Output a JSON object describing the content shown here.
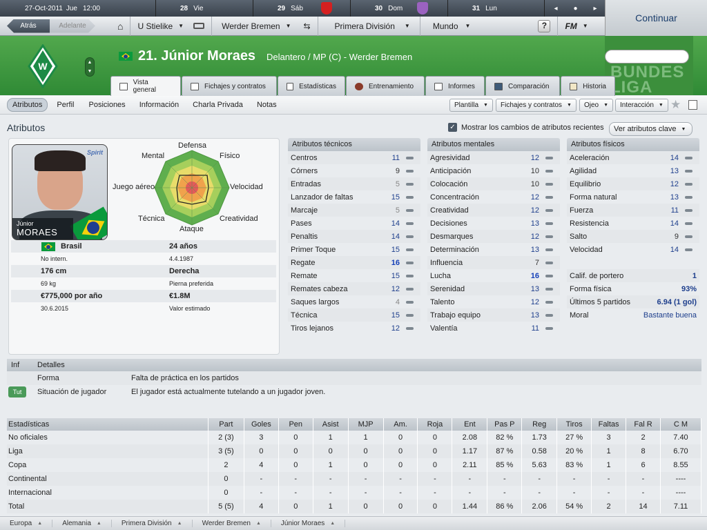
{
  "topbar": {
    "date": "27-Oct-2011",
    "weekday": "Jue",
    "time": "12:00",
    "days": [
      {
        "num": "28",
        "name": "Vie",
        "crest": ""
      },
      {
        "num": "29",
        "name": "Sáb",
        "crest": "#d42020"
      },
      {
        "num": "30",
        "name": "Dom",
        "crest": "#9b62c0"
      },
      {
        "num": "31",
        "name": "Lun",
        "crest": ""
      }
    ]
  },
  "nav": {
    "back": "Atrás",
    "forward": "Adelante",
    "manager": "U Stielike",
    "club": "Werder Bremen",
    "league": "Primera División",
    "world": "Mundo",
    "help": "?",
    "fm": "FM",
    "continue": "Continuar"
  },
  "player": {
    "title": "21. Júnior Moraes",
    "position": "Delantero / MP (C) - Werder Bremen",
    "first_name": "Júnior",
    "last_name": "MORAES",
    "logo_text": "Spirit"
  },
  "tabs": [
    "Vista general",
    "Fichajes y contratos",
    "Estadísticas",
    "Entrenamiento",
    "Informes",
    "Comparación",
    "Historia"
  ],
  "subnav": [
    "Atributos",
    "Perfil",
    "Posiciones",
    "Información",
    "Charla Privada",
    "Notas"
  ],
  "toolbar": {
    "squad": "Plantilla",
    "transfers": "Fichajes y contratos",
    "scout": "Ojeo",
    "interaction": "Interacción"
  },
  "section": {
    "title": "Atributos",
    "show_changes": "Mostrar los cambios de atributos recientes",
    "key_attrs": "Ver atributos clave"
  },
  "radar_labels": {
    "top": "Defensa",
    "tr": "Físico",
    "r": "Velocidad",
    "br": "Creatividad",
    "b": "Ataque",
    "bl": "Técnica",
    "l": "Juego aéreo",
    "tl": "Mental"
  },
  "info": {
    "nation": "Brasil",
    "caps": "No intern.",
    "age": "24 años",
    "dob": "4.4.1987",
    "height": "176 cm",
    "weight": "69 kg",
    "foot": "Derecha",
    "foot_label": "Pierna preferida",
    "wage": "€775,000 por año",
    "expires": "30.6.2015",
    "value": "€1.8M",
    "value_label": "Valor estimado"
  },
  "technical": {
    "title": "Atributos técnicos",
    "rows": [
      {
        "n": "Centros",
        "v": "11",
        "s": ""
      },
      {
        "n": "Córners",
        "v": "9",
        "s": "blk"
      },
      {
        "n": "Entradas",
        "v": "5",
        "s": "dim"
      },
      {
        "n": "Lanzador de faltas",
        "v": "15",
        "s": ""
      },
      {
        "n": "Marcaje",
        "v": "5",
        "s": "dim"
      },
      {
        "n": "Pases",
        "v": "14",
        "s": ""
      },
      {
        "n": "Penaltis",
        "v": "14",
        "s": ""
      },
      {
        "n": "Primer Toque",
        "v": "15",
        "s": ""
      },
      {
        "n": "Regate",
        "v": "16",
        "s": "hi"
      },
      {
        "n": "Remate",
        "v": "15",
        "s": ""
      },
      {
        "n": "Remates cabeza",
        "v": "12",
        "s": ""
      },
      {
        "n": "Saques largos",
        "v": "4",
        "s": "dim"
      },
      {
        "n": "Técnica",
        "v": "15",
        "s": ""
      },
      {
        "n": "Tiros lejanos",
        "v": "12",
        "s": ""
      }
    ]
  },
  "mental": {
    "title": "Atributos mentales",
    "rows": [
      {
        "n": "Agresividad",
        "v": "12",
        "s": ""
      },
      {
        "n": "Anticipación",
        "v": "10",
        "s": "blk"
      },
      {
        "n": "Colocación",
        "v": "10",
        "s": "blk"
      },
      {
        "n": "Concentración",
        "v": "12",
        "s": ""
      },
      {
        "n": "Creatividad",
        "v": "12",
        "s": ""
      },
      {
        "n": "Decisiones",
        "v": "13",
        "s": ""
      },
      {
        "n": "Desmarques",
        "v": "12",
        "s": ""
      },
      {
        "n": "Determinación",
        "v": "13",
        "s": ""
      },
      {
        "n": "Influencia",
        "v": "7",
        "s": "blk"
      },
      {
        "n": "Lucha",
        "v": "16",
        "s": "hi"
      },
      {
        "n": "Serenidad",
        "v": "13",
        "s": ""
      },
      {
        "n": "Talento",
        "v": "12",
        "s": ""
      },
      {
        "n": "Trabajo equipo",
        "v": "13",
        "s": ""
      },
      {
        "n": "Valentía",
        "v": "11",
        "s": ""
      }
    ]
  },
  "physical": {
    "title": "Atributos físicos",
    "rows": [
      {
        "n": "Aceleración",
        "v": "14",
        "s": ""
      },
      {
        "n": "Agilidad",
        "v": "13",
        "s": ""
      },
      {
        "n": "Equilibrio",
        "v": "12",
        "s": ""
      },
      {
        "n": "Forma natural",
        "v": "13",
        "s": ""
      },
      {
        "n": "Fuerza",
        "v": "11",
        "s": ""
      },
      {
        "n": "Resistencia",
        "v": "14",
        "s": ""
      },
      {
        "n": "Salto",
        "v": "9",
        "s": "blk"
      },
      {
        "n": "Velocidad",
        "v": "14",
        "s": ""
      }
    ],
    "extra": [
      {
        "n": "Calif. de portero",
        "v": "1"
      },
      {
        "n": "Forma física",
        "v": "93%"
      },
      {
        "n": "Últimos 5 partidos",
        "v": "6.94 (1 gol)"
      },
      {
        "n": "Moral",
        "v": "Bastante buena"
      }
    ]
  },
  "details": {
    "head_inf": "Inf",
    "head_det": "Detalles",
    "rows": [
      {
        "badge": "",
        "label": "Forma",
        "text": "Falta de práctica en los partidos"
      },
      {
        "badge": "Tut",
        "label": "Situación de jugador",
        "text": "El jugador está actualmente tutelando a un jugador joven."
      }
    ]
  },
  "stats": {
    "headers": [
      "Estadísticas",
      "Part",
      "Goles",
      "Pen",
      "Asist",
      "MJP",
      "Am.",
      "Roja",
      "Ent",
      "Pas P",
      "Reg",
      "Tiros",
      "Faltas",
      "Fal R",
      "C M"
    ],
    "rows": [
      [
        "No oficiales",
        "2 (3)",
        "3",
        "0",
        "1",
        "1",
        "0",
        "0",
        "2.08",
        "82 %",
        "1.73",
        "27 %",
        "3",
        "2",
        "7.40"
      ],
      [
        "Liga",
        "3 (5)",
        "0",
        "0",
        "0",
        "0",
        "0",
        "0",
        "1.17",
        "87 %",
        "0.58",
        "20 %",
        "1",
        "8",
        "6.70"
      ],
      [
        "Copa",
        "2",
        "4",
        "0",
        "1",
        "0",
        "0",
        "0",
        "2.11",
        "85 %",
        "5.63",
        "83 %",
        "1",
        "6",
        "8.55"
      ],
      [
        "Continental",
        "0",
        "-",
        "-",
        "-",
        "-",
        "-",
        "-",
        "-",
        "-",
        "-",
        "-",
        "-",
        "-",
        "----"
      ],
      [
        "Internacional",
        "0",
        "-",
        "-",
        "-",
        "-",
        "-",
        "-",
        "-",
        "-",
        "-",
        "-",
        "-",
        "-",
        "----"
      ],
      [
        "Total",
        "5 (5)",
        "4",
        "0",
        "1",
        "0",
        "0",
        "0",
        "1.44",
        "86 %",
        "2.06",
        "54 %",
        "2",
        "14",
        "7.11"
      ]
    ]
  },
  "breadcrumbs": [
    "Europa",
    "Alemania",
    "Primera División",
    "Werder Bremen",
    "Júnior Moraes"
  ],
  "search": {
    "placeholder": ""
  },
  "banner": {
    "text": "BUNDES LIGA"
  },
  "colors": {
    "header_green": "#3f9b3f",
    "link_blue": "#1d3e8c",
    "werder_green": "#1d8a46"
  }
}
